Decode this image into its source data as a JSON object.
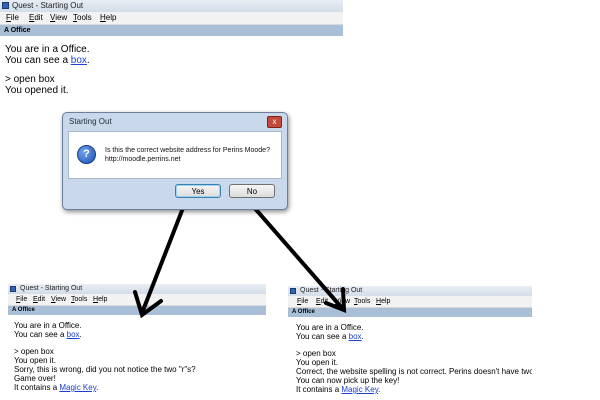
{
  "window": {
    "title": "Quest - Starting Out",
    "menu": [
      "File",
      "Edit",
      "View",
      "Tools",
      "Help"
    ],
    "location": "A Office"
  },
  "main_window": {
    "lines": [
      {
        "text": "You are in a Office."
      },
      {
        "prefix": "You can see a ",
        "link": "box",
        "suffix": "."
      },
      {
        "text": ""
      },
      {
        "text": "> open box"
      },
      {
        "text": "You opened it."
      }
    ]
  },
  "dialog": {
    "title": "Starting Out",
    "close": "x",
    "message": "Is this the correct website address for Perins Moode?",
    "url": "http://moodle.perrins.net",
    "yes": "Yes",
    "no": "No"
  },
  "result_wrong": {
    "lines": [
      {
        "text": "You are in a Office."
      },
      {
        "prefix": "You can see a ",
        "link": "box",
        "suffix": "."
      },
      {
        "text": ""
      },
      {
        "text": "> open box"
      },
      {
        "text": "You open it."
      },
      {
        "text": "Sorry, this is wrong, did you not notice the two \"r\"s?"
      },
      {
        "text": "Game over!"
      },
      {
        "prefix": "It contains a ",
        "link": "Magic Key",
        "suffix": "."
      }
    ]
  },
  "result_correct": {
    "lines": [
      {
        "text": "You are in a Office."
      },
      {
        "prefix": "You can see a ",
        "link": "box",
        "suffix": "."
      },
      {
        "text": ""
      },
      {
        "text": "> open box"
      },
      {
        "text": "You open it."
      },
      {
        "text": "Correct, the website spelling is not correct. Perins doesn't have two \"r\"s"
      },
      {
        "text": "You can now pick up the key!"
      },
      {
        "prefix": "It contains a ",
        "link": "Magic Key",
        "suffix": "."
      }
    ]
  },
  "colors": {
    "location_bar": "#a9bfd8",
    "link": "#1a3fd1",
    "dialog_frame": "#c9d8ea",
    "arrow": "#000000"
  }
}
